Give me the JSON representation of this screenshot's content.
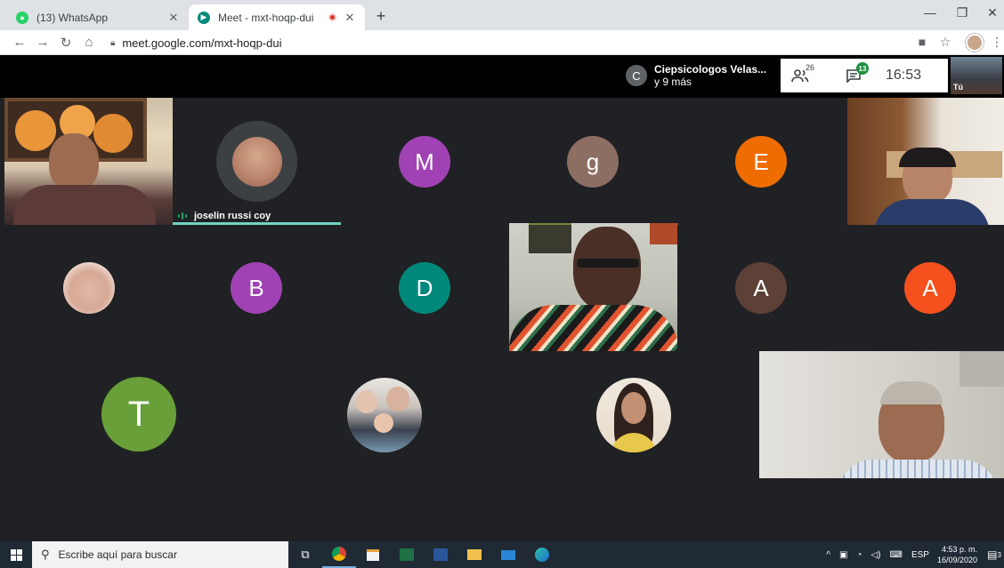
{
  "browser": {
    "tabs": [
      {
        "title": "(13) WhatsApp",
        "icon": "whatsapp-icon",
        "active": false
      },
      {
        "title": "Meet - mxt-hoqp-dui",
        "icon": "meet-icon",
        "active": true
      }
    ],
    "url": "meet.google.com/mxt-hoqp-dui"
  },
  "meet": {
    "chip": {
      "initial": "C",
      "line1": "Ciepsicologos Velas...",
      "line2": "y 9 más"
    },
    "people_count": "26",
    "chat_count": "13",
    "time": "16:53",
    "self_label": "Tú",
    "speaker_name": "joselin russi coy",
    "participants": [
      {
        "initial": "M",
        "color": "#a142b4"
      },
      {
        "initial": "g",
        "color": "#8d6e63"
      },
      {
        "initial": "E",
        "color": "#ef6c00"
      },
      {
        "initial": "B",
        "color": "#a142b4"
      },
      {
        "initial": "D",
        "color": "#00897b"
      },
      {
        "initial": "A",
        "color": "#5d4037"
      },
      {
        "initial": "A",
        "color": "#f4511e"
      },
      {
        "initial": "T",
        "color": "#689f38"
      }
    ]
  },
  "taskbar": {
    "search_placeholder": "Escribe aquí para buscar",
    "language": "ESP",
    "clock_time": "4:53 p. m.",
    "clock_date": "16/09/2020",
    "notifications": "3"
  }
}
